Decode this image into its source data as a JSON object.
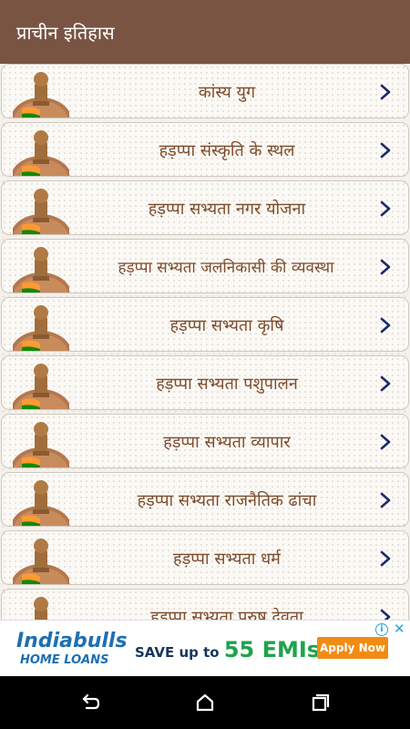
{
  "appbar": {
    "title": "प्राचीन इतिहास"
  },
  "list": {
    "items": [
      {
        "label": "कांस्य युग"
      },
      {
        "label": "हड़प्पा संस्कृति के स्थल"
      },
      {
        "label": "हड़प्पा सभ्यता नगर योजना"
      },
      {
        "label": "हड़प्पा सभ्यता जलनिकासी की व्यवस्था"
      },
      {
        "label": "हड़प्पा सभ्यता कृषि"
      },
      {
        "label": "हड़प्पा सभ्यता पशुपालन"
      },
      {
        "label": "हड़प्पा सभ्यता व्यापार"
      },
      {
        "label": "हड़प्पा सभ्यता राजनैतिक ढांचा"
      },
      {
        "label": "हड़प्पा सभ्यता धर्म"
      },
      {
        "label": "हड़प्पा सभ्यता पुरुष देवता"
      }
    ],
    "item_icon": "emblem-icon",
    "chevron_icon": "chevron-right-icon"
  },
  "ad": {
    "brand": "Indiabulls",
    "brand_sub": "HOME LOANS",
    "offer_prefix": "SAVE up to",
    "offer_number": "55 EMIs",
    "offer_mark": "*",
    "apply": "Apply Now"
  },
  "navbar": {
    "icons": [
      "back-icon",
      "home-icon",
      "recents-icon"
    ]
  },
  "colors": {
    "appbar": "#7a5443",
    "label": "#7d4c2d",
    "chevron": "#1a2a6e",
    "nav": "#000000"
  }
}
